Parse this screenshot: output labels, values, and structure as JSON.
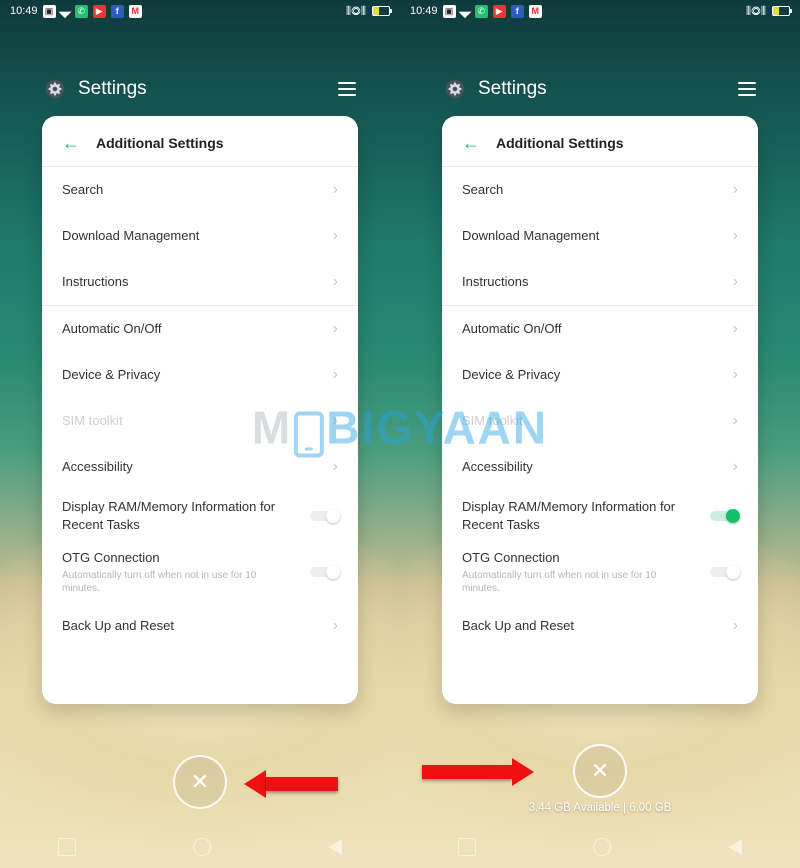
{
  "status": {
    "time": "10:49"
  },
  "header": {
    "title": "Settings"
  },
  "card": {
    "title": "Additional Settings",
    "rows": {
      "search": "Search",
      "download": "Download Management",
      "instructions": "Instructions",
      "auto_onoff": "Automatic On/Off",
      "device_privacy": "Device & Privacy",
      "sim_toolkit": "SIM toolkit",
      "accessibility": "Accessibility",
      "ram_info": "Display RAM/Memory Information for Recent Tasks",
      "otg": "OTG Connection",
      "otg_sub": "Automatically turn off when not in use for 10 minutes.",
      "backup": "Back Up and Reset"
    }
  },
  "ram_status": "3.44 GB Available | 6.00 GB",
  "watermark": {
    "a": "M",
    "b": "BIGYAAN"
  }
}
